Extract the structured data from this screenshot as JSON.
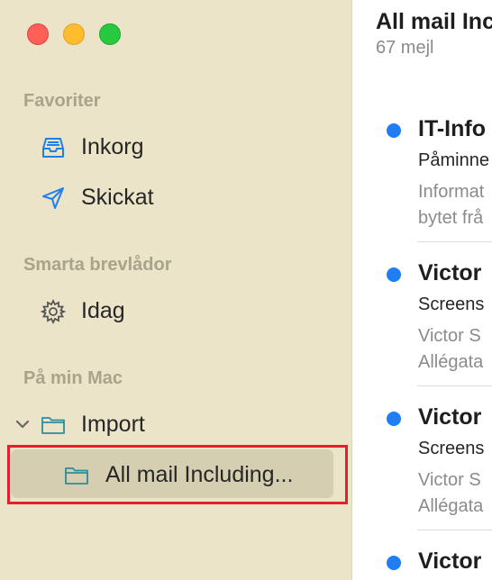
{
  "sidebar": {
    "sections": {
      "favorites": "Favoriter",
      "smart": "Smarta brevlådor",
      "onmac": "På min Mac"
    },
    "items": {
      "inbox": "Inkorg",
      "sent": "Skickat",
      "today": "Idag",
      "import": "Import",
      "allmail": "All mail Including..."
    }
  },
  "main": {
    "title": "All mail Inc",
    "count": "67 mejl",
    "messages": [
      {
        "sender": "IT-Info",
        "subject": "Påminne",
        "preview1": "Informat",
        "preview2": "bytet frå"
      },
      {
        "sender": "Victor",
        "subject": "Screens",
        "preview1": "Victor S",
        "preview2": "Allégata"
      },
      {
        "sender": "Victor",
        "subject": "Screens",
        "preview1": "Victor S",
        "preview2": "Allégata"
      },
      {
        "sender": "Victor",
        "subject": "",
        "preview1": "",
        "preview2": ""
      }
    ]
  },
  "colors": {
    "sidebar_bg": "#ebe4c9",
    "selected_bg": "#d6ceb1",
    "unread_dot": "#1f7ef1",
    "highlight_border": "#e2202b",
    "folder_icon": "#2d8c9b"
  }
}
